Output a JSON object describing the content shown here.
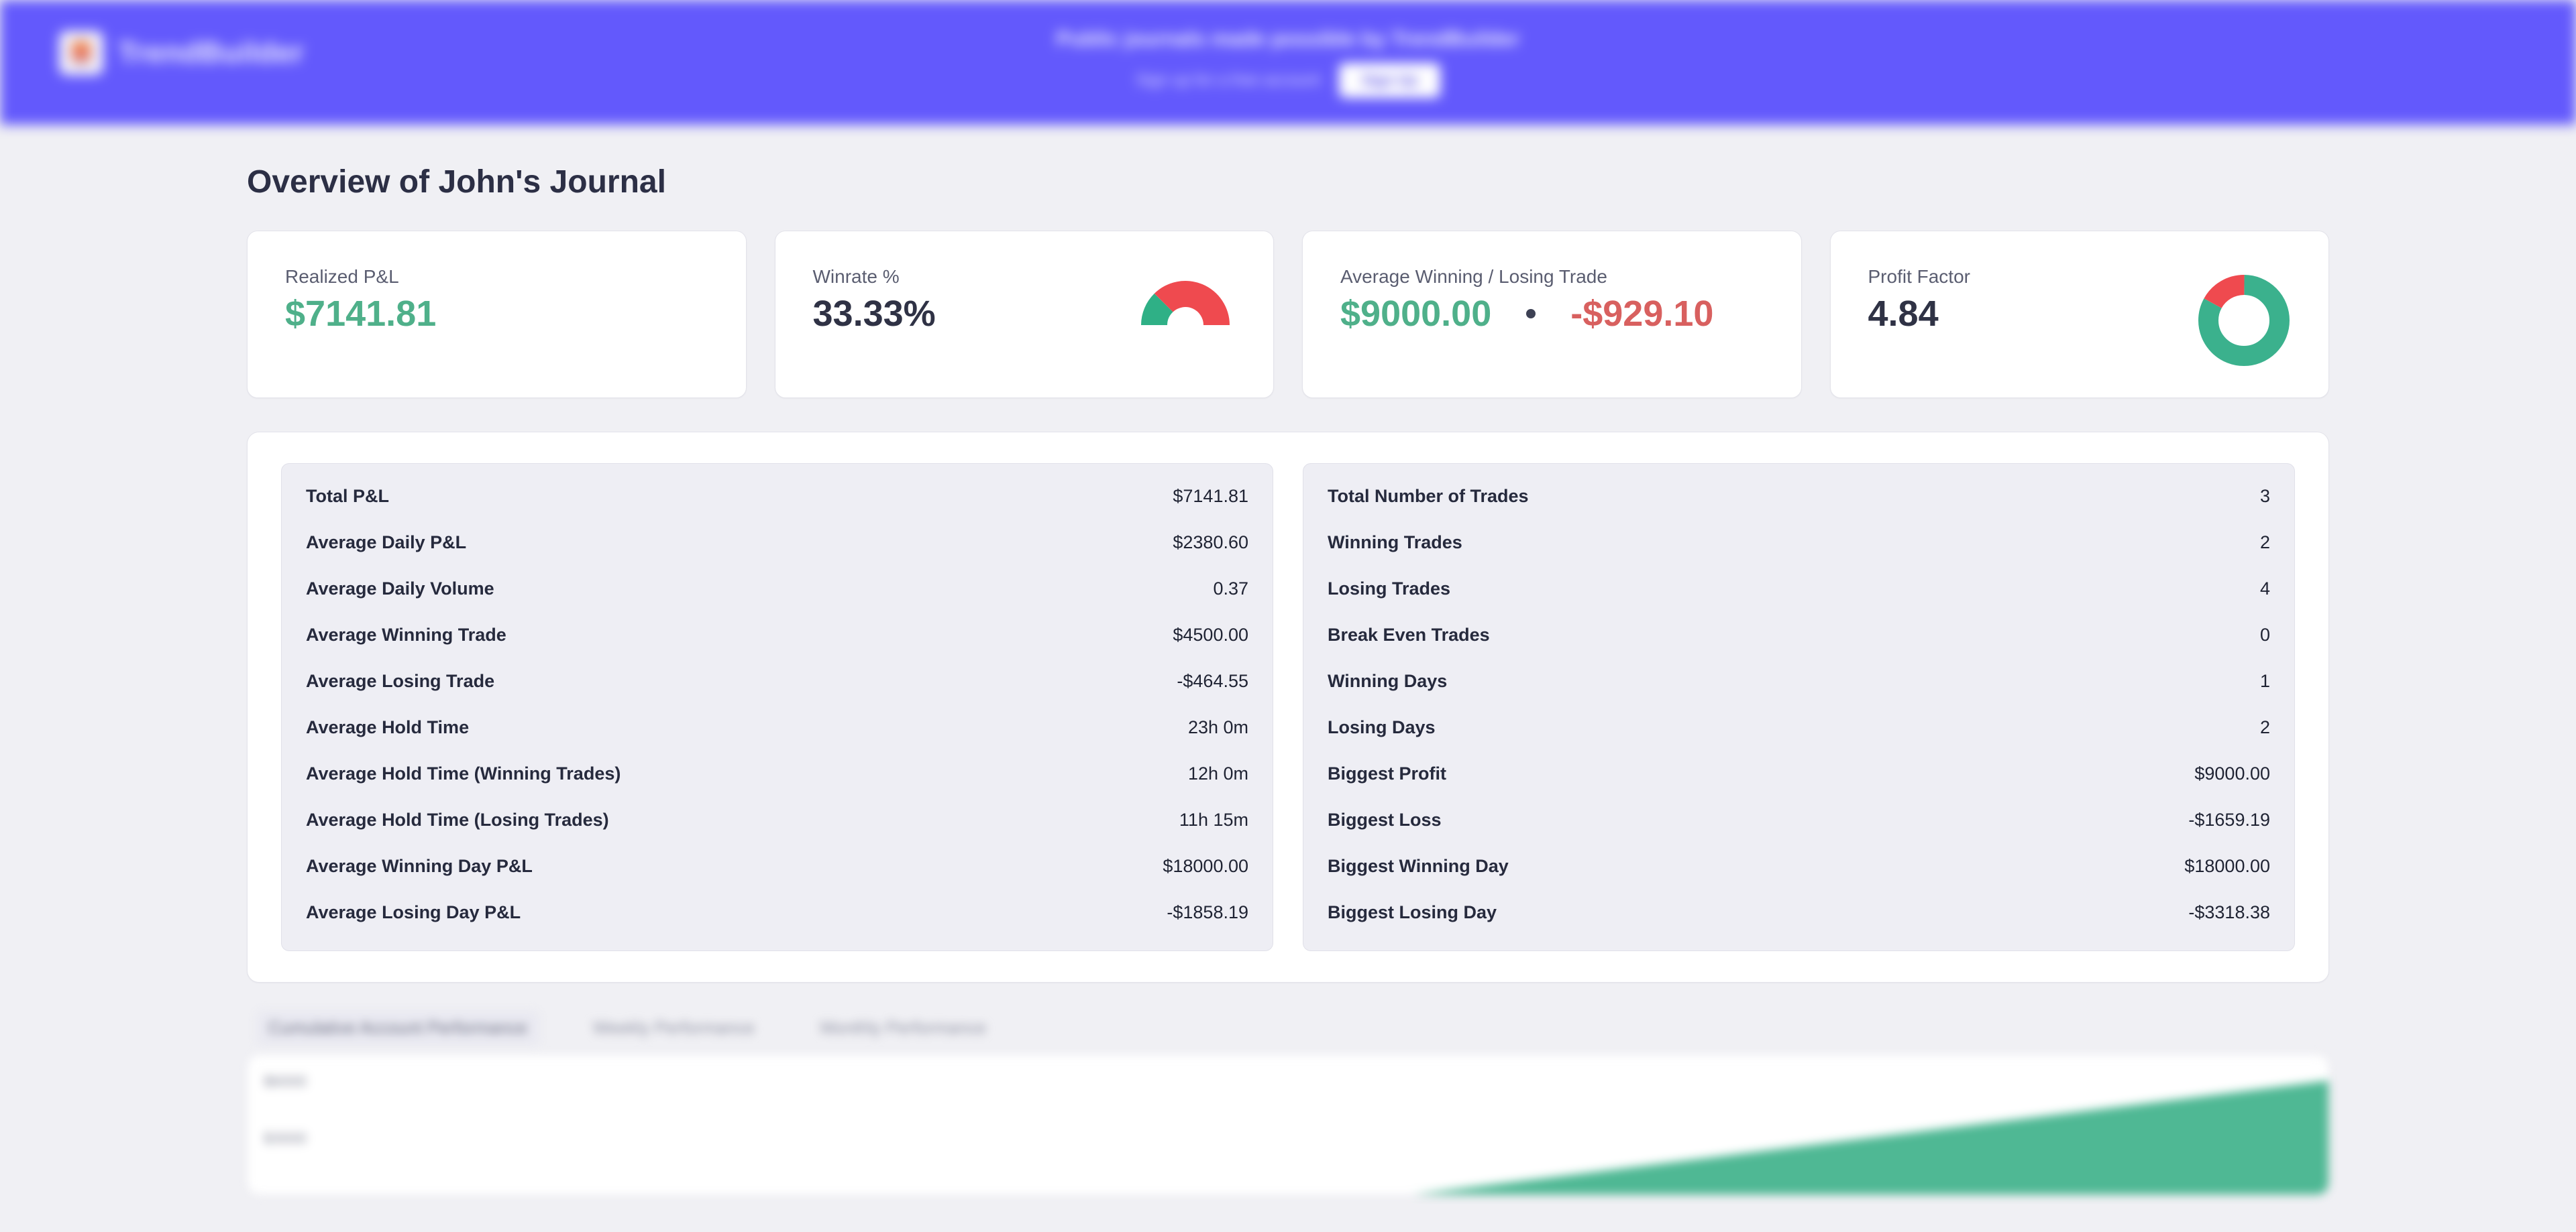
{
  "banner": {
    "brand_name": "TrendBuilder",
    "brand_icon": "trendbuilder-logo-icon",
    "promo_title": "Public journals made possible by TrendBuilder",
    "promo_subtitle": "Sign up for a free account",
    "promo_button": "Sign Up",
    "background_color": "#6359fc"
  },
  "page": {
    "title": "Overview of John's Journal"
  },
  "colors": {
    "green": "#4fb08a",
    "red": "#d8605f",
    "text": "#2f3245",
    "muted": "#5a5d70",
    "panel": "#eeeef4",
    "accent": "#6359fc"
  },
  "kpis": [
    {
      "label": "Realized P&L",
      "value": "$7141.81",
      "value_tone": "green",
      "viz": "none"
    },
    {
      "label": "Winrate %",
      "value": "33.33%",
      "value_tone": "neutral",
      "viz": "half-donut-gauge"
    },
    {
      "label": "Average Winning / Losing Trade",
      "value": "$9000.00",
      "value_tone": "green",
      "value_secondary": "-$929.10",
      "value_secondary_tone": "red",
      "viz": "dot-separator"
    },
    {
      "label": "Profit Factor",
      "value": "4.84",
      "value_tone": "neutral",
      "viz": "donut"
    }
  ],
  "chart_data": [
    {
      "type": "pie",
      "title": "Winrate %",
      "variant": "half-donut-gauge",
      "labels": [
        "Wins",
        "Losses"
      ],
      "values": [
        33.33,
        66.67
      ],
      "colors": [
        "#2fb086",
        "#ef4a4f"
      ],
      "unit": "%"
    },
    {
      "type": "pie",
      "title": "Profit Factor",
      "variant": "donut",
      "labels": [
        "Profit",
        "Loss"
      ],
      "values": [
        82.9,
        17.1
      ],
      "colors": [
        "#3bb18d",
        "#ef4a4f"
      ],
      "unit": "%"
    },
    {
      "type": "area",
      "title": "Cumulative Account Performance",
      "x": [],
      "values": [],
      "ylabel": "",
      "xlabel": "",
      "grid": false,
      "series_color": "#4fb894",
      "note": "blurred rising cumulative equity curve"
    }
  ],
  "stats": {
    "left": [
      {
        "label": "Total P&L",
        "value": "$7141.81"
      },
      {
        "label": "Average Daily P&L",
        "value": "$2380.60"
      },
      {
        "label": "Average Daily Volume",
        "value": "0.37"
      },
      {
        "label": "Average Winning Trade",
        "value": "$4500.00"
      },
      {
        "label": "Average Losing Trade",
        "value": "-$464.55"
      },
      {
        "label": "Average Hold Time",
        "value": "23h 0m"
      },
      {
        "label": "Average Hold Time (Winning Trades)",
        "value": "12h 0m"
      },
      {
        "label": "Average Hold Time (Losing Trades)",
        "value": "11h 15m"
      },
      {
        "label": "Average Winning Day P&L",
        "value": "$18000.00"
      },
      {
        "label": "Average Losing Day P&L",
        "value": "-$1858.19"
      }
    ],
    "right": [
      {
        "label": "Total Number of Trades",
        "value": "3"
      },
      {
        "label": "Winning Trades",
        "value": "2"
      },
      {
        "label": "Losing Trades",
        "value": "4"
      },
      {
        "label": "Break Even Trades",
        "value": "0"
      },
      {
        "label": "Winning Days",
        "value": "1"
      },
      {
        "label": "Losing Days",
        "value": "2"
      },
      {
        "label": "Biggest Profit",
        "value": "$9000.00"
      },
      {
        "label": "Biggest Loss",
        "value": "-$1659.19"
      },
      {
        "label": "Biggest Winning Day",
        "value": "$18000.00"
      },
      {
        "label": "Biggest Losing Day",
        "value": "-$3318.38"
      }
    ]
  },
  "chart_section": {
    "tabs": [
      {
        "label": "Cumulative Account Performance",
        "active": true
      },
      {
        "label": "Weekly Performance",
        "active": false
      },
      {
        "label": "Monthly Performance",
        "active": false
      }
    ],
    "y_ticks": [
      "$6000",
      "$3000"
    ]
  }
}
